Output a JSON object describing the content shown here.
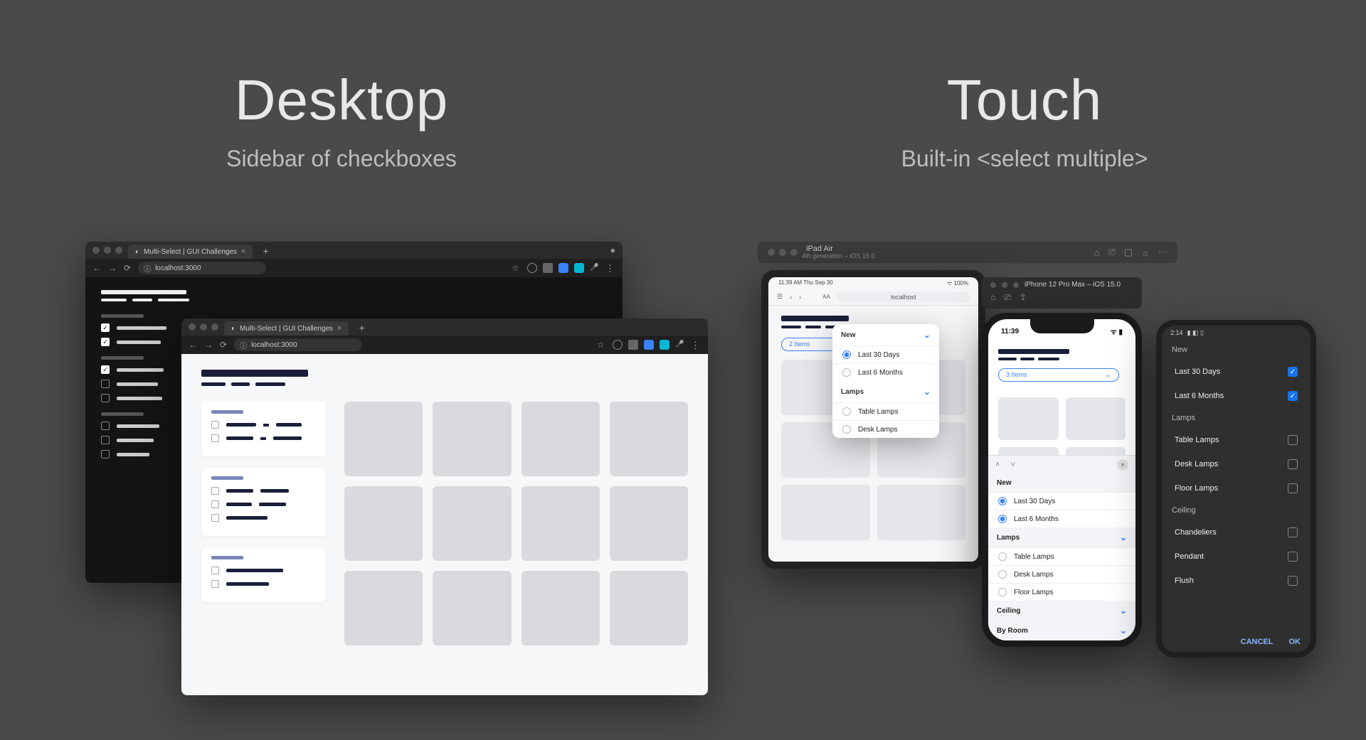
{
  "left": {
    "headline": "Desktop",
    "subhead": "Sidebar of checkboxes",
    "browser": {
      "tab_title": "Multi-Select | GUI Challenges",
      "url": "localhost:3000"
    }
  },
  "right": {
    "headline": "Touch",
    "subhead": "Built-in <select multiple>",
    "ipad_sim": {
      "title": "iPad Air",
      "sub": "4th generation – iOS 15.0"
    },
    "iphone_sim": {
      "title": "iPhone 12 Pro Max – iOS 15.0"
    },
    "ipad": {
      "status_left": "11:39 AM   Thu Sep 30",
      "url": "localhost",
      "pill": "2 Items",
      "popover": {
        "groups": [
          {
            "head": "New",
            "rows": [
              {
                "label": "Last 30 Days",
                "on": true
              },
              {
                "label": "Last 6 Months",
                "on": false
              }
            ]
          },
          {
            "head": "Lamps",
            "rows": [
              {
                "label": "Table Lamps",
                "on": false
              },
              {
                "label": "Desk Lamps",
                "on": false
              }
            ]
          }
        ]
      }
    },
    "iphone": {
      "time": "11:39",
      "pill": "3 Items",
      "sheet": {
        "groups": [
          {
            "head": "New",
            "chev": false,
            "rows": [
              {
                "label": "Last 30 Days",
                "on": true
              },
              {
                "label": "Last 6 Months",
                "on": true
              }
            ]
          },
          {
            "head": "Lamps",
            "chev": true,
            "rows": [
              {
                "label": "Table Lamps",
                "on": false
              },
              {
                "label": "Desk Lamps",
                "on": false
              },
              {
                "label": "Floor Lamps",
                "on": false
              }
            ]
          },
          {
            "head": "Ceiling",
            "chev": true,
            "rows": []
          },
          {
            "head": "By Room",
            "chev": true,
            "rows": []
          }
        ]
      }
    },
    "android": {
      "time": "2:14",
      "groups": [
        {
          "head": "New",
          "rows": [
            {
              "label": "Last 30 Days",
              "on": true
            },
            {
              "label": "Last 6 Months",
              "on": true
            }
          ]
        },
        {
          "head": "Lamps",
          "rows": [
            {
              "label": "Table Lamps",
              "on": false
            },
            {
              "label": "Desk Lamps",
              "on": false
            },
            {
              "label": "Floor Lamps",
              "on": false
            }
          ]
        },
        {
          "head": "Ceiling",
          "rows": [
            {
              "label": "Chandeliers",
              "on": false
            },
            {
              "label": "Pendant",
              "on": false
            },
            {
              "label": "Flush",
              "on": false
            }
          ]
        }
      ],
      "cancel": "CANCEL",
      "ok": "OK"
    }
  }
}
